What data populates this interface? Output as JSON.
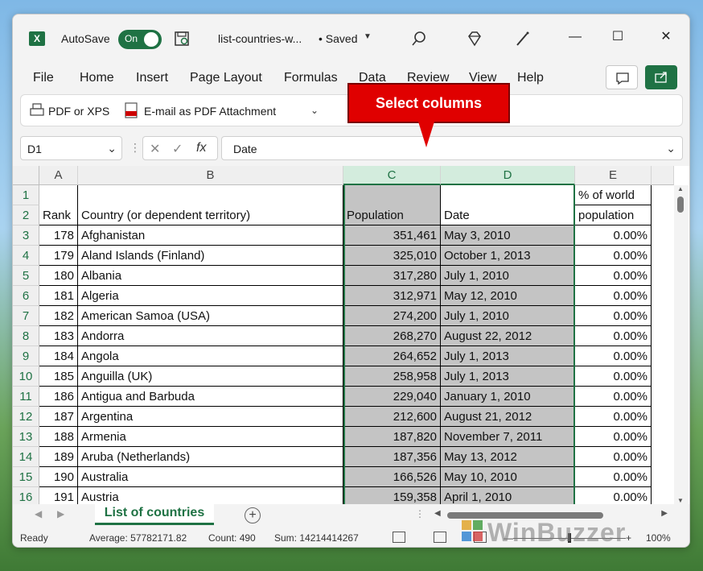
{
  "app": {
    "autosave_label": "AutoSave",
    "autosave_state": "On",
    "filename": "list-countries-w...",
    "save_status": "• Saved"
  },
  "menu": [
    "File",
    "Home",
    "Insert",
    "Page Layout",
    "Formulas",
    "Data",
    "Review",
    "View",
    "Help"
  ],
  "ribbon": {
    "pdf_xps": "PDF or XPS",
    "email_pdf": "E-mail as PDF Attachment"
  },
  "callout": "Select columns",
  "formula_bar": {
    "name_box": "D1",
    "fx": "fx",
    "value": "Date"
  },
  "columns": [
    "A",
    "B",
    "C",
    "D",
    "E"
  ],
  "header_rows": {
    "row1": {
      "e": "% of world"
    },
    "row2": {
      "a": "Rank",
      "b": "Country (or dependent territory)",
      "c": "Population",
      "d": "Date",
      "e": "population"
    }
  },
  "rows": [
    {
      "n": "3",
      "rank": "178",
      "country": "Afghanistan",
      "pop": "351,461",
      "date": "May 3, 2010",
      "pct": "0.00%"
    },
    {
      "n": "4",
      "rank": "179",
      "country": "Aland Islands (Finland)",
      "pop": "325,010",
      "date": "October 1, 2013",
      "pct": "0.00%"
    },
    {
      "n": "5",
      "rank": "180",
      "country": "Albania",
      "pop": "317,280",
      "date": "July 1, 2010",
      "pct": "0.00%"
    },
    {
      "n": "6",
      "rank": "181",
      "country": "Algeria",
      "pop": "312,971",
      "date": "May 12, 2010",
      "pct": "0.00%"
    },
    {
      "n": "7",
      "rank": "182",
      "country": "American Samoa (USA)",
      "pop": "274,200",
      "date": "July 1, 2010",
      "pct": "0.00%"
    },
    {
      "n": "8",
      "rank": "183",
      "country": "Andorra",
      "pop": "268,270",
      "date": "August 22, 2012",
      "pct": "0.00%"
    },
    {
      "n": "9",
      "rank": "184",
      "country": "Angola",
      "pop": "264,652",
      "date": "July 1, 2013",
      "pct": "0.00%"
    },
    {
      "n": "10",
      "rank": "185",
      "country": "Anguilla (UK)",
      "pop": "258,958",
      "date": "July 1, 2013",
      "pct": "0.00%"
    },
    {
      "n": "11",
      "rank": "186",
      "country": "Antigua and Barbuda",
      "pop": "229,040",
      "date": "January 1, 2010",
      "pct": "0.00%"
    },
    {
      "n": "12",
      "rank": "187",
      "country": "Argentina",
      "pop": "212,600",
      "date": "August 21, 2012",
      "pct": "0.00%"
    },
    {
      "n": "13",
      "rank": "188",
      "country": "Armenia",
      "pop": "187,820",
      "date": "November 7, 2011",
      "pct": "0.00%"
    },
    {
      "n": "14",
      "rank": "189",
      "country": "Aruba (Netherlands)",
      "pop": "187,356",
      "date": "May 13, 2012",
      "pct": "0.00%"
    },
    {
      "n": "15",
      "rank": "190",
      "country": "Australia",
      "pop": "166,526",
      "date": "May 10, 2010",
      "pct": "0.00%"
    },
    {
      "n": "16",
      "rank": "191",
      "country": "Austria",
      "pop": "159,358",
      "date": "April 1, 2010",
      "pct": "0.00%"
    }
  ],
  "sheet_tab": "List of countries",
  "status": {
    "ready": "Ready",
    "average": "Average: 57782171.82",
    "count": "Count: 490",
    "sum": "Sum: 14214414267",
    "zoom": "100%"
  },
  "watermark": "WinBuzzer",
  "colors": {
    "accent": "#1f7244",
    "callout": "#e00000",
    "selection_fill": "#c4c4c4"
  }
}
